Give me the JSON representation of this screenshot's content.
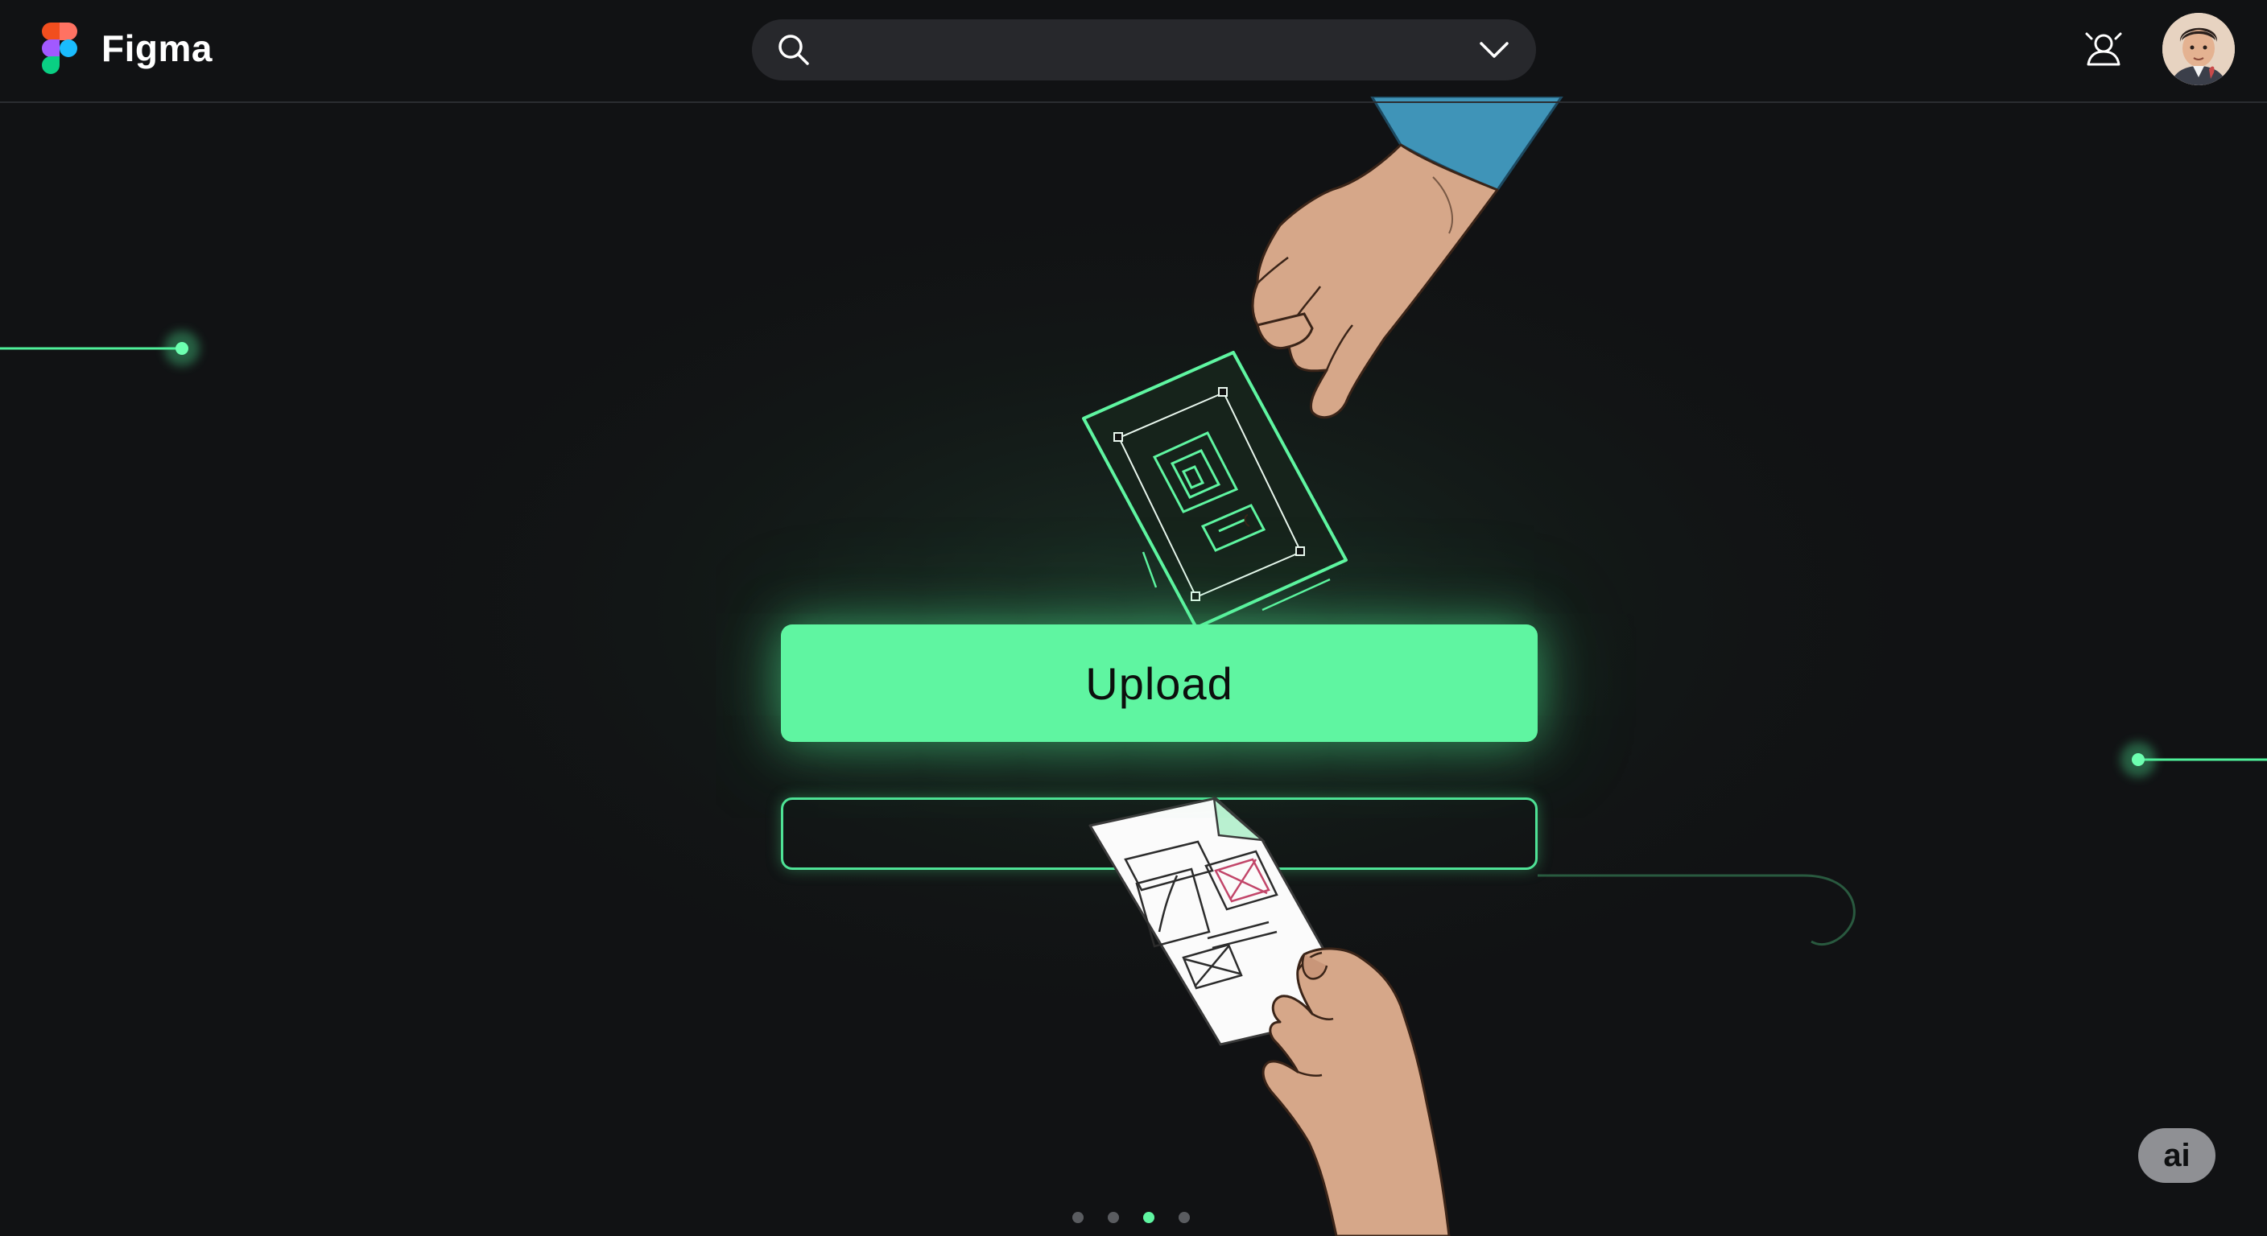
{
  "app": {
    "name": "Figma",
    "accent_color": "#5ff5a1",
    "background_color": "#111214"
  },
  "header": {
    "logo_icon": "figma-logo",
    "search": {
      "placeholder": "",
      "value": "",
      "icon": "search-icon",
      "dropdown_icon": "chevron-down-icon"
    },
    "presence_icon": "user-presence-icon",
    "avatar_icon": "user-avatar"
  },
  "hero": {
    "primary_button_label": "Upload",
    "drop_zone_label": ""
  },
  "pager": {
    "total": 4,
    "active_index": 2
  },
  "ai_badge": {
    "label": "ai"
  }
}
